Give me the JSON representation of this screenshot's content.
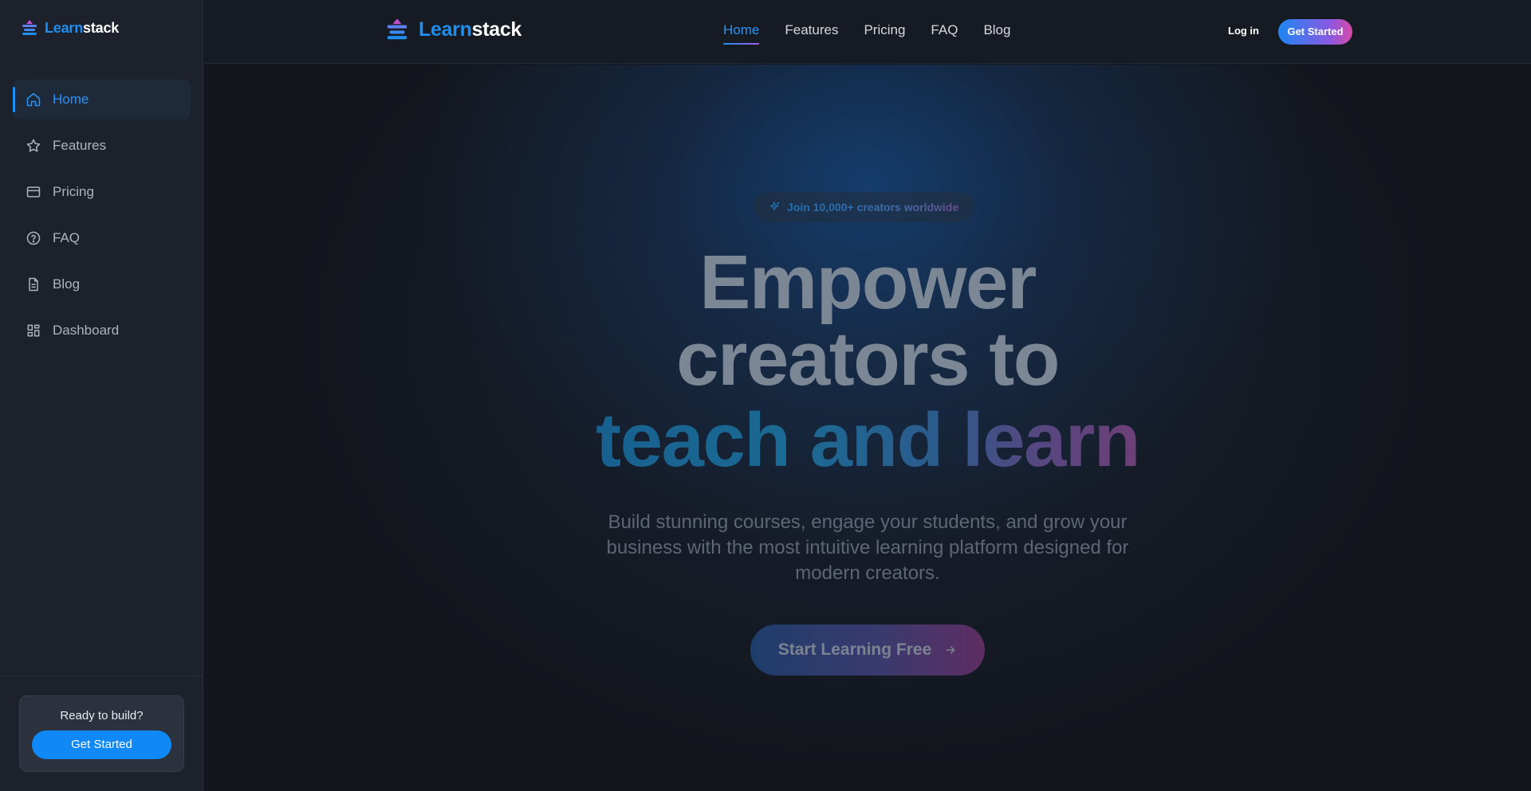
{
  "brand": {
    "part1": "Learn",
    "part2": "stack"
  },
  "sidebar": {
    "items": [
      {
        "label": "Home",
        "icon": "home-icon",
        "active": true
      },
      {
        "label": "Features",
        "icon": "star-icon"
      },
      {
        "label": "Pricing",
        "icon": "credit-card-icon"
      },
      {
        "label": "FAQ",
        "icon": "help-circle-icon"
      },
      {
        "label": "Blog",
        "icon": "document-icon"
      },
      {
        "label": "Dashboard",
        "icon": "grid-icon"
      }
    ],
    "cta": {
      "title": "Ready to build?",
      "button": "Get Started"
    }
  },
  "header": {
    "nav": [
      "Home",
      "Features",
      "Pricing",
      "FAQ",
      "Blog"
    ],
    "active": "Home",
    "login": "Log in",
    "get_started": "Get Started"
  },
  "hero": {
    "badge": "Join 10,000+ creators worldwide",
    "title_line1": "Empower",
    "title_line2": "creators to",
    "title_line3": "teach and learn",
    "subtitle": "Build stunning courses, engage your students, and grow your business with the most intuitive learning platform designed for modern creators.",
    "cta": "Start Learning Free"
  },
  "colors": {
    "accent": "#1e8ff0",
    "gradient_end": "#d74aa6",
    "background": "#13161d",
    "sidebar": "#1c212b"
  }
}
